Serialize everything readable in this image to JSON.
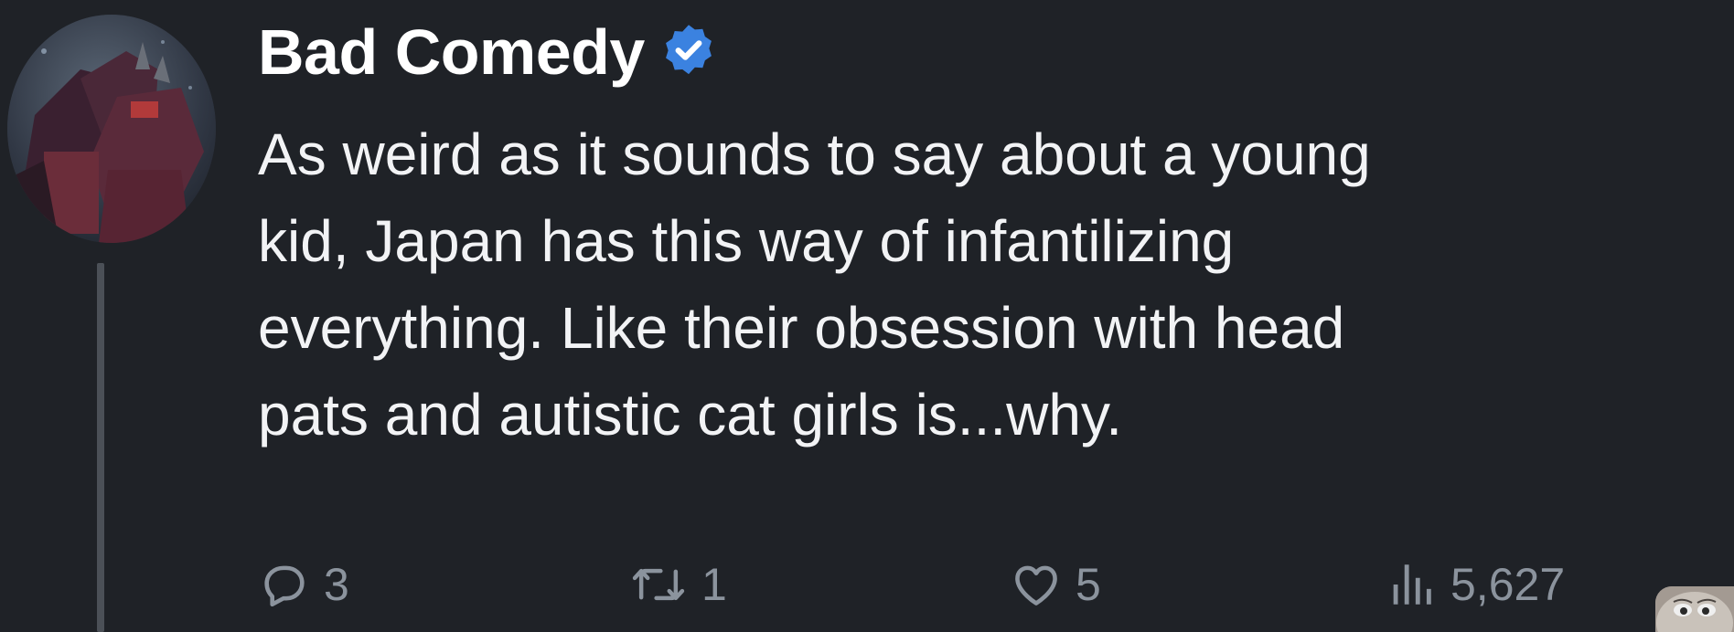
{
  "tweet": {
    "display_name": "Bad Comedy",
    "verified": true,
    "text": "As weird as it sounds to say about a young\nkid, Japan has this way of infantilizing\neverything. Like their obsession with head\npats and autistic cat girls is...why.",
    "actions": {
      "replies": "3",
      "retweets": "1",
      "likes": "5",
      "views": "5,627"
    }
  },
  "icons": {
    "reply": "reply-icon",
    "retweet": "retweet-icon",
    "like": "heart-icon",
    "views": "views-icon",
    "verified": "verified-badge-icon"
  },
  "colors": {
    "background": "#1f2227",
    "text": "#f2f3f5",
    "muted": "#8b939d",
    "verified_blue": "#3b82e0",
    "thread_line": "#4b5057"
  }
}
